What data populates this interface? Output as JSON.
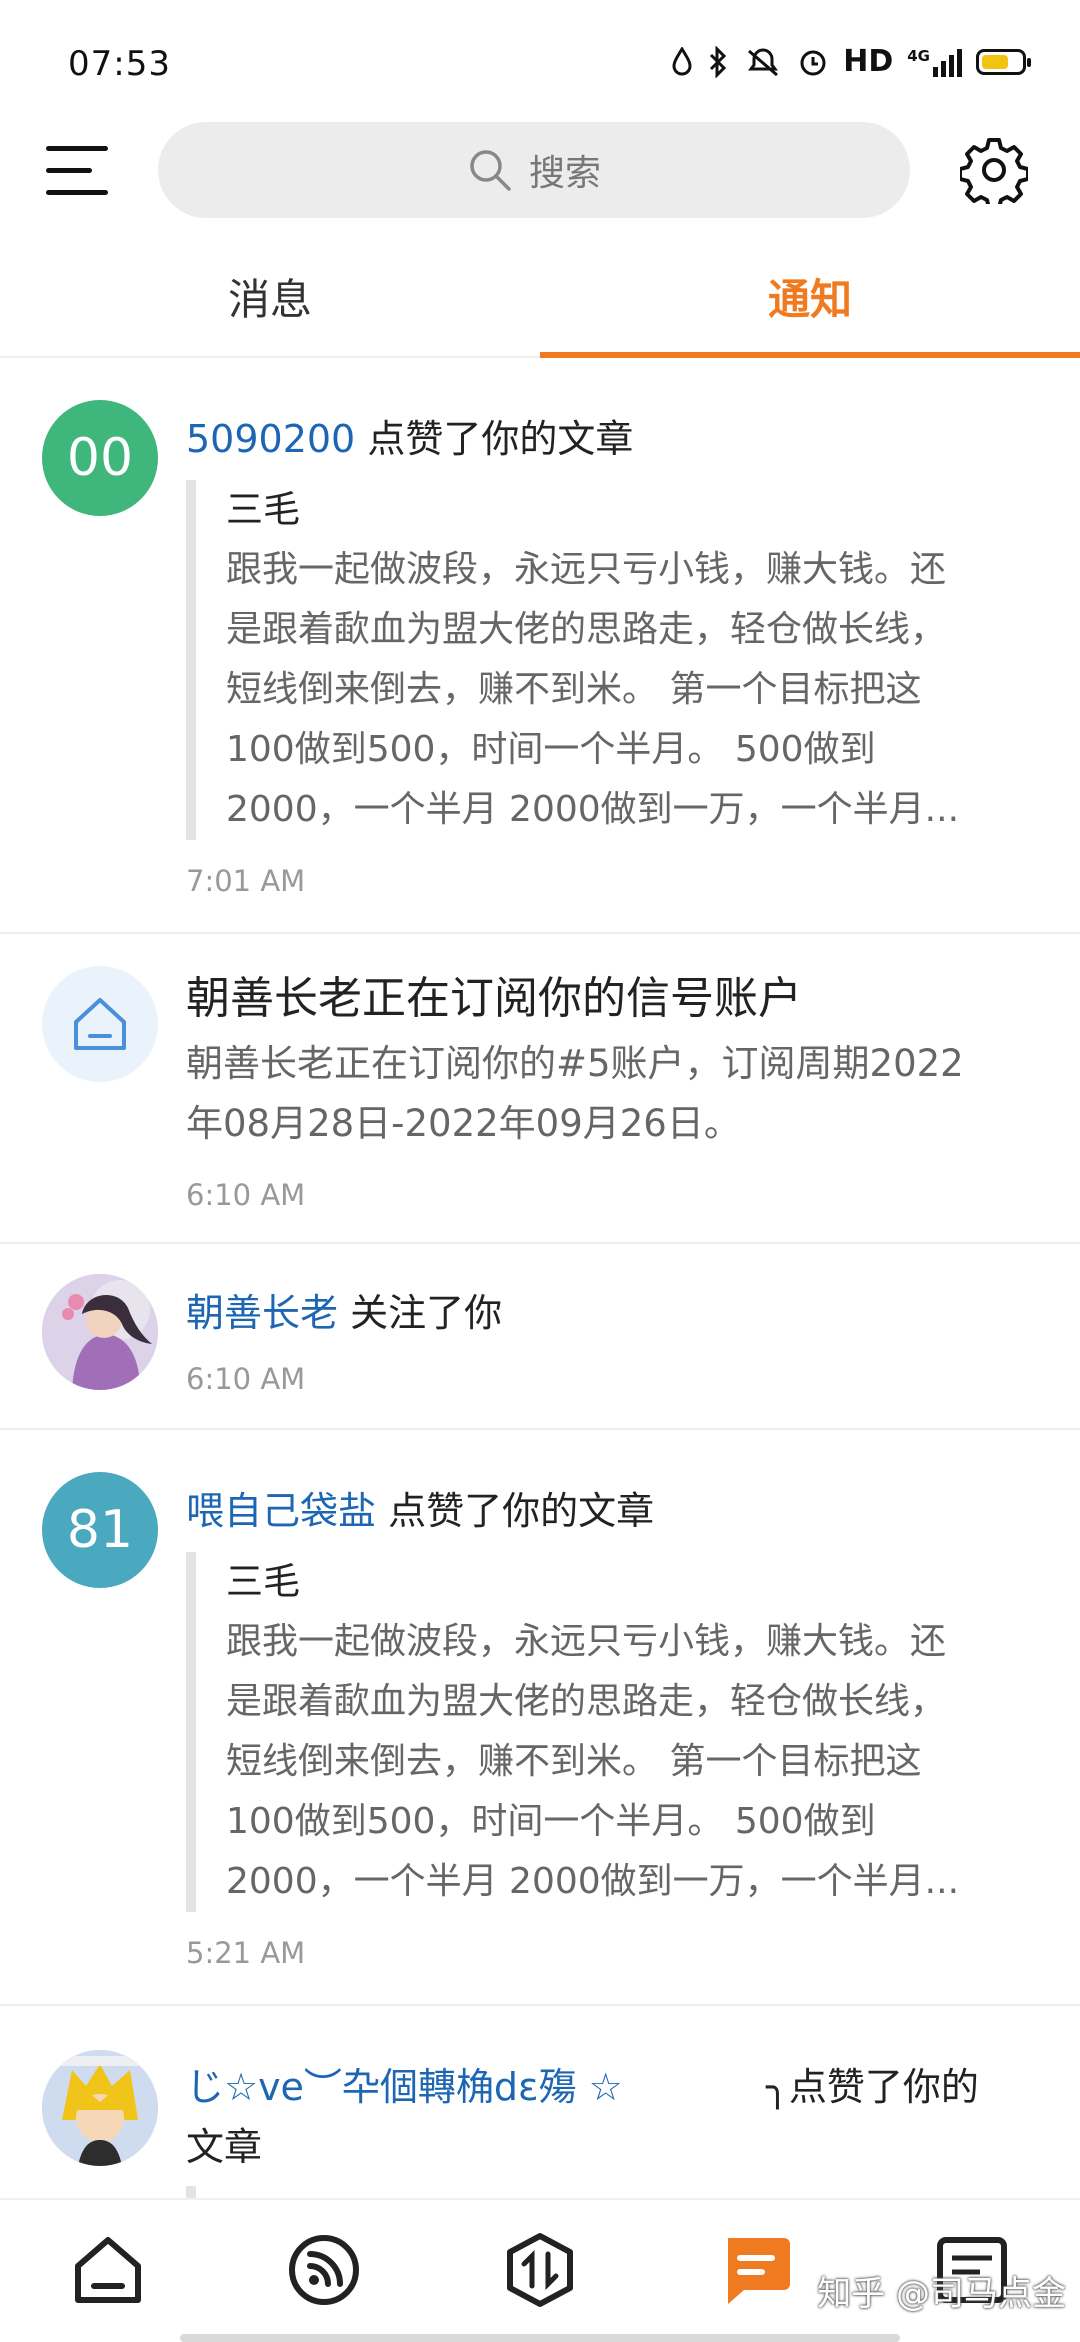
{
  "status_bar": {
    "time": "07:53",
    "icons": [
      "water-drop-icon",
      "bluetooth-icon",
      "mute-icon",
      "alarm-icon",
      "hd-icon",
      "signal-icon",
      "battery-icon"
    ],
    "hd_text": "HD",
    "net_text": "4G"
  },
  "top_bar": {
    "search_placeholder": "搜索"
  },
  "tabs": [
    {
      "label": "消息",
      "active": false
    },
    {
      "label": "通知",
      "active": true
    }
  ],
  "colors": {
    "accent": "#f07a20",
    "link_blue": "#1d66b3",
    "avatar_green": "#3fb67b",
    "avatar_teal": "#4aa8bf"
  },
  "notifications": [
    {
      "avatar_text": "00",
      "user": "5090200",
      "action": " 点赞了你的文章",
      "quote_title": "三毛",
      "quote_lines": [
        "跟我一起做波段，永远只亏小钱，赚大钱。还",
        "是跟着歃血为盟大佬的思路走，轻仓做长线，",
        "短线倒来倒去，赚不到米。 第一个目标把这",
        "100做到500，时间一个半月。 500做到",
        "2000，一个半月 2000做到一万，一个半月..."
      ],
      "time": "7:01 AM"
    },
    {
      "title": "朝善长老正在订阅你的信号账户",
      "lines": [
        "朝善长老正在订阅你的#5账户，订阅周期2022",
        "年08月28日-2022年09月26日。"
      ],
      "time": "6:10 AM"
    },
    {
      "user": "朝善长老",
      "action": " 关注了你",
      "time": "6:10 AM"
    },
    {
      "avatar_text": "81",
      "user": "喂自己袋盐",
      "action": " 点赞了你的文章",
      "quote_title": "三毛",
      "quote_lines": [
        "跟我一起做波段，永远只亏小钱，赚大钱。还",
        "是跟着歃血为盟大佬的思路走，轻仓做长线，",
        "短线倒来倒去，赚不到米。 第一个目标把这",
        "100做到500，时间一个半月。 500做到",
        "2000，一个半月 2000做到一万，一个半月..."
      ],
      "time": "5:21 AM"
    },
    {
      "user": "じ☆ve︶卆個轉桷dε殤 ☆",
      "action_tail": "╮点赞了你的",
      "action_cont": "文章"
    }
  ],
  "bottom_nav": [
    {
      "name": "home",
      "active": false
    },
    {
      "name": "feed",
      "active": false
    },
    {
      "name": "trade",
      "active": false
    },
    {
      "name": "messages",
      "active": true
    },
    {
      "name": "quotes",
      "active": false
    }
  ],
  "watermark": "知乎 @司马点金"
}
